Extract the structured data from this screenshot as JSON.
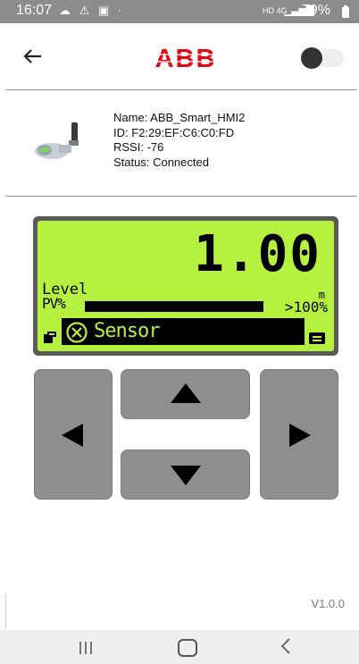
{
  "status_bar": {
    "time": "16:07",
    "left_icons": "☁ ⚠ ▣ ·",
    "network": "HD 4G",
    "signal": "▁▃▅▇",
    "battery": "79%"
  },
  "header": {
    "logo_text": "ABB",
    "logo_color": "#e30613",
    "toggle_state": "off"
  },
  "device": {
    "name": "Name: ABB_Smart_HMI2",
    "id": "ID: F2:29:EF:C6:C0:FD",
    "rssi": "RSSI: -76",
    "status": "Status: Connected"
  },
  "lcd": {
    "value": "1.00",
    "label_level": "Level",
    "label_pv": "PV%",
    "unit": "m",
    "bar_label": ">100%",
    "status_text": "Sensor",
    "background_color": "#b7f13f"
  },
  "keypad": {
    "left": "left-arrow-icon",
    "right": "right-arrow-icon",
    "up": "up-arrow-icon",
    "down": "down-arrow-icon"
  },
  "version": "V1.0.0",
  "nav_bar": {
    "recent": "recent-apps-icon",
    "home": "home-icon",
    "back": "back-icon"
  }
}
